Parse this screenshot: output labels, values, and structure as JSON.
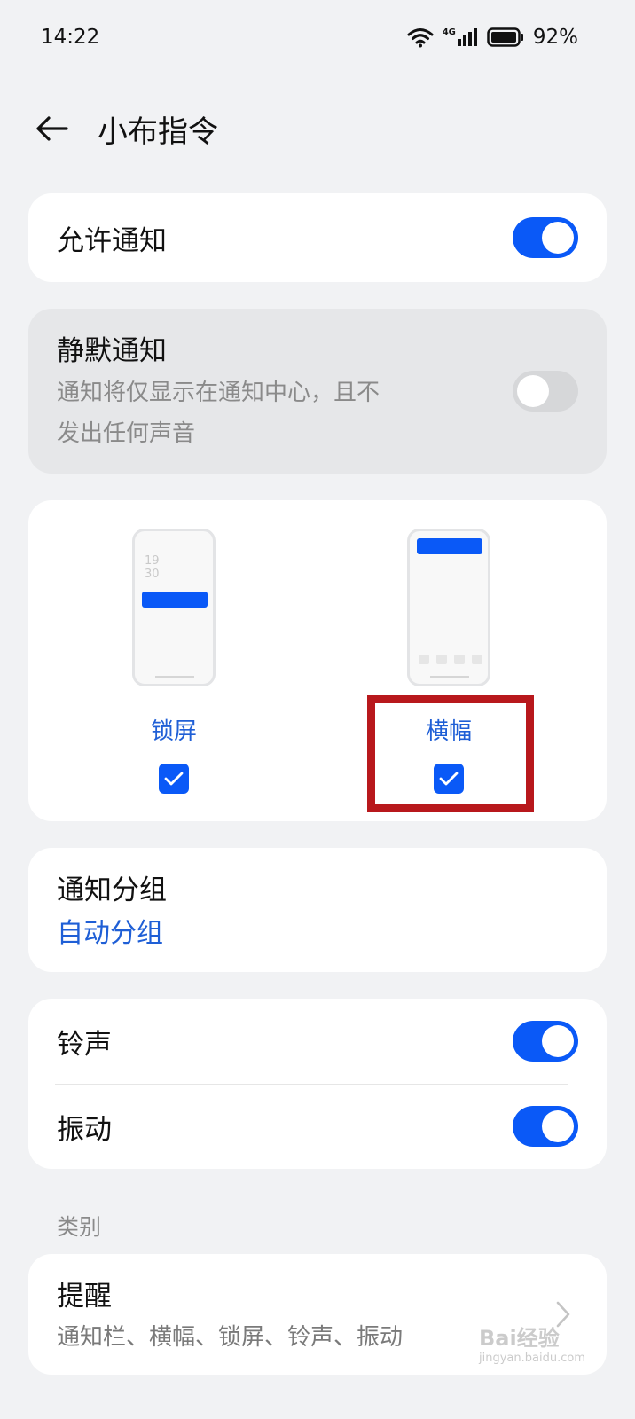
{
  "status": {
    "time": "14:22",
    "network": "4G",
    "battery": "92%"
  },
  "header": {
    "title": "小布指令"
  },
  "allow_notify": {
    "label": "允许通知",
    "on": true
  },
  "silent_notify": {
    "label": "静默通知",
    "desc_line1": "通知将仅显示在通知中心，且不",
    "desc_line2": "发出任何声音",
    "on": false
  },
  "display_styles": {
    "lock_screen": {
      "label": "锁屏",
      "checked": true,
      "clock_h": "19",
      "clock_m": "30"
    },
    "banner": {
      "label": "横幅",
      "checked": true
    }
  },
  "grouping": {
    "label": "通知分组",
    "value": "自动分组"
  },
  "ringtone": {
    "label": "铃声",
    "on": true
  },
  "vibration": {
    "label": "振动",
    "on": true
  },
  "category": {
    "section_label": "类别",
    "reminder": {
      "label": "提醒",
      "desc": "通知栏、横幅、锁屏、铃声、振动"
    }
  },
  "watermark": {
    "text": "Bai经验",
    "sub": "jingyan.baidu.com"
  },
  "colors": {
    "accent": "#0a59f7",
    "link": "#1f5fd6",
    "highlight": "#b8181c"
  }
}
